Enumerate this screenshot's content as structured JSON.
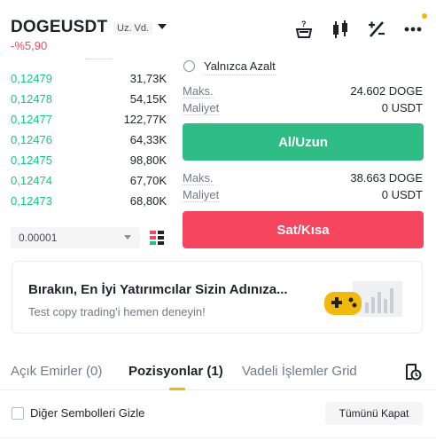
{
  "header": {
    "symbol": "DOGEUSDT",
    "contract_badge": "Uz. Vd.",
    "price_change": "-%5,90",
    "icons": [
      "calculator-icon",
      "candlestick-chart-icon",
      "percent-icon",
      "more-icon"
    ],
    "notification_dot_color": "#f0b90b"
  },
  "order_book": {
    "rows": [
      {
        "price": "0,12479",
        "qty": "31,73K"
      },
      {
        "price": "0,12478",
        "qty": "54,15K"
      },
      {
        "price": "0,12477",
        "qty": "122,77K"
      },
      {
        "price": "0,12476",
        "qty": "64,33K"
      },
      {
        "price": "0,12475",
        "qty": "98,80K"
      },
      {
        "price": "0,12474",
        "qty": "67,70K"
      },
      {
        "price": "0,12473",
        "qty": "68,80K"
      }
    ],
    "precision": "0.00001"
  },
  "order_form": {
    "reduce_only": "Yalnızca Azalt",
    "buy": {
      "max_label": "Maks.",
      "max_value": "24.602 DOGE",
      "cost_label": "Maliyet",
      "cost_value": "0 USDT",
      "button": "Al/Uzun"
    },
    "sell": {
      "max_label": "Maks.",
      "max_value": "38.663 DOGE",
      "cost_label": "Maliyet",
      "cost_value": "0 USDT",
      "button": "Sat/Kısa"
    }
  },
  "promo": {
    "title": "Bırakın, En İyi Yatırımcılar Sizin Adınıza...",
    "subtitle": "Test copy trading'i hemen deneyin!"
  },
  "tabs": [
    {
      "label": "Açık Emirler (0)",
      "active": false
    },
    {
      "label": "Pozisyonlar (1)",
      "active": true
    },
    {
      "label": "Vadeli İşlemler Grid",
      "active": false
    }
  ],
  "positions": {
    "hide_other_symbols": "Diğer Sembolleri Gizle",
    "close_all": "Tümünü Kapat"
  },
  "colors": {
    "buy": "#2ebd85",
    "sell": "#f6465d",
    "accent": "#f0b90b",
    "bid_price": "#0ecb81"
  }
}
